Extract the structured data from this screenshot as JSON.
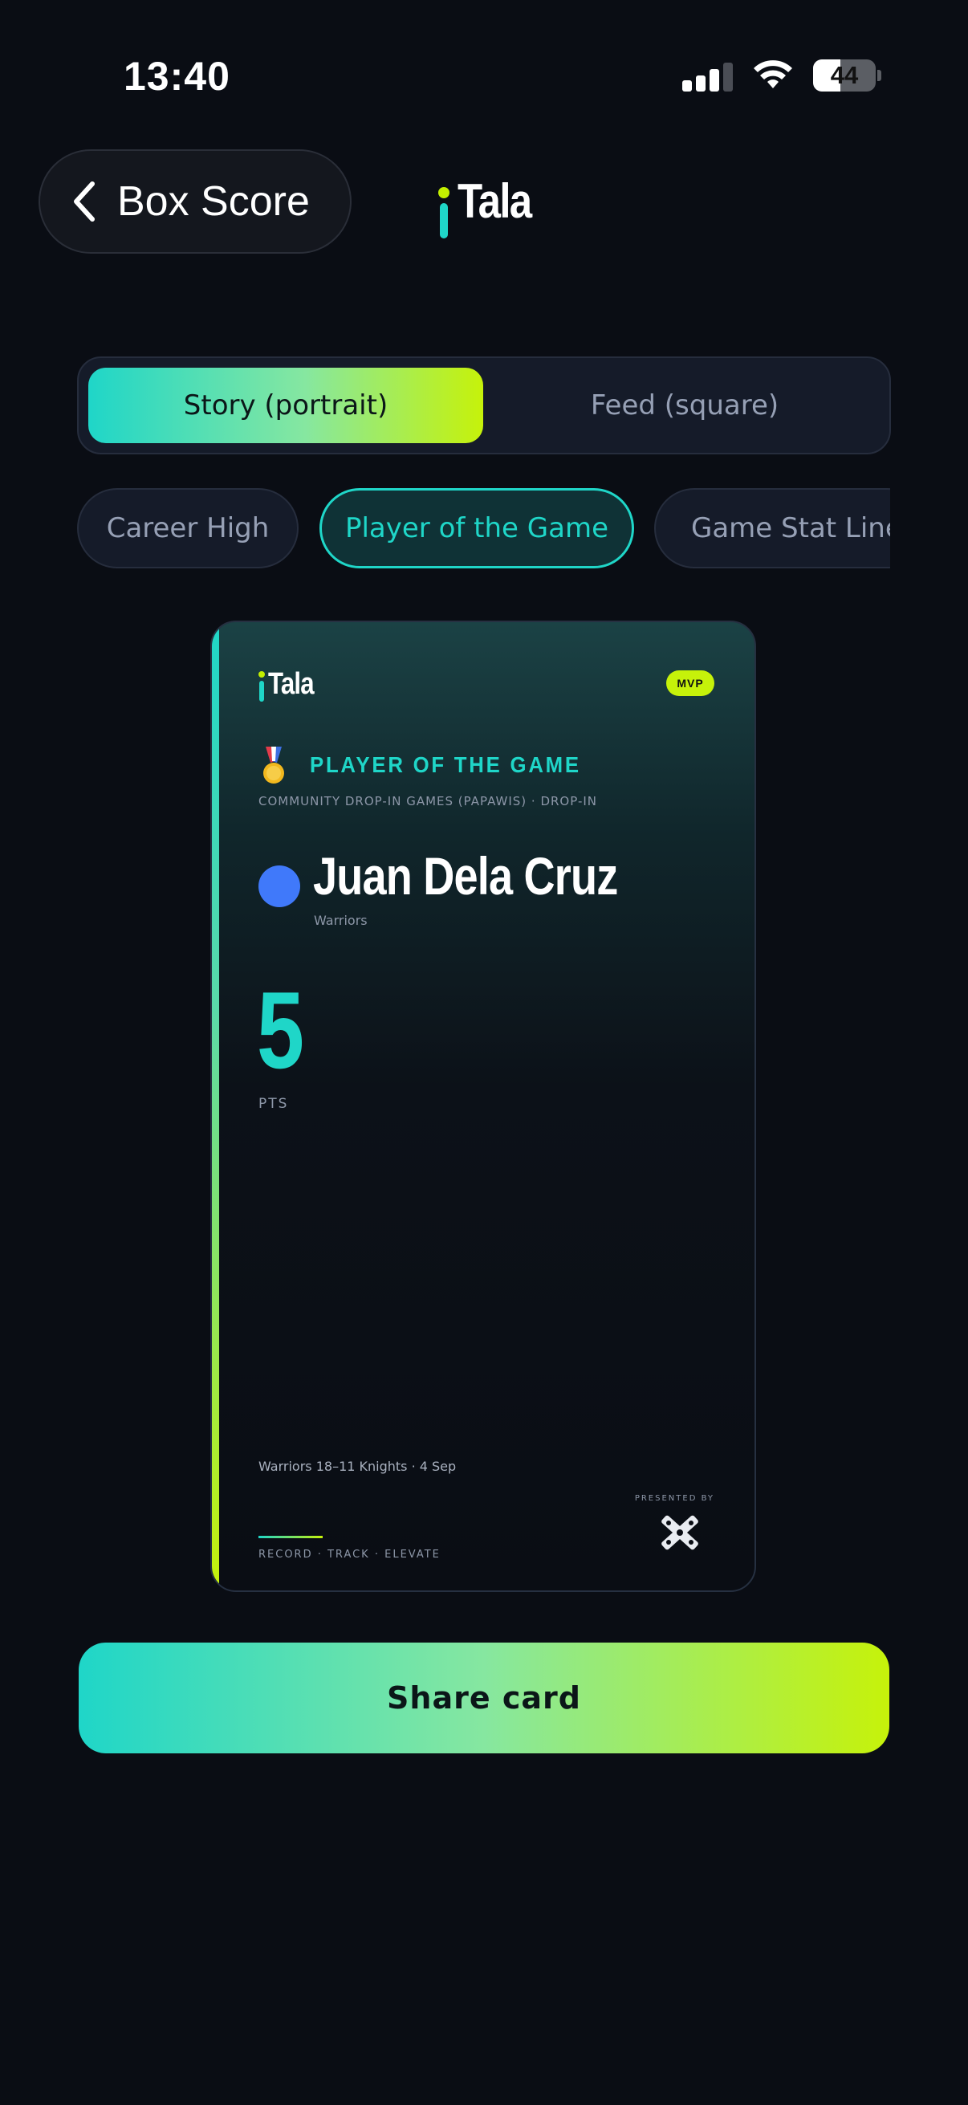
{
  "status_bar": {
    "time": "13:40",
    "battery_level": "44",
    "icons": [
      "cellular-signal-icon",
      "wifi-icon",
      "battery-icon"
    ]
  },
  "header": {
    "back_label": "Box Score",
    "back_icon": "chevron-left-icon",
    "logo_text": "Tala"
  },
  "format_toggle": {
    "options": [
      {
        "label": "Story (portrait)",
        "selected": true
      },
      {
        "label": "Feed (square)",
        "selected": false
      }
    ]
  },
  "card_types": [
    {
      "label": "Career High",
      "selected": false
    },
    {
      "label": "Player of the Game",
      "selected": true
    },
    {
      "label": "Game Stat Line",
      "selected": false
    }
  ],
  "card": {
    "logo_text": "Tala",
    "badge": "MVP",
    "title": "PLAYER OF THE GAME",
    "title_icon": "medal-icon",
    "league_line": "COMMUNITY DROP-IN GAMES (PAPAWIS) · DROP-IN",
    "player_name": "Juan Dela Cruz",
    "team": "Warriors",
    "stat_value": "5",
    "stat_label": "PTS",
    "result_line": "Warriors 18–11 Knights · 4 Sep",
    "presented_by": "PRESENTED BY",
    "tagline": "RECORD · TRACK · ELEVATE"
  },
  "share_button": {
    "label": "Share card"
  },
  "colors": {
    "background": "#0a0d14",
    "accent_teal": "#1fd6c8",
    "accent_lime": "#c6f20a",
    "avatar_blue": "#4079fa"
  }
}
